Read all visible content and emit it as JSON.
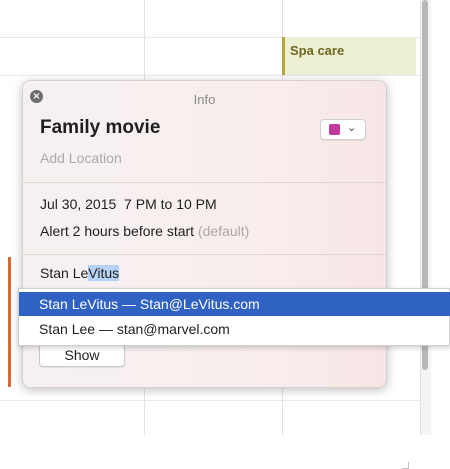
{
  "calendar": {
    "event_spa": {
      "label": "Spa care",
      "color": "#eef0d4"
    }
  },
  "popover": {
    "header": "Info",
    "event_title": "Family movie",
    "location_placeholder": "Add Location",
    "color_swatch": "#c2399b",
    "date_time": "Jul 30, 2015  7 PM to 10 PM",
    "alert_text": "Alert 2 hours before start",
    "alert_default": "(default)",
    "invitee_typed": "Stan Le",
    "invitee_completion": "Vitus",
    "show_button": "Show"
  },
  "autocomplete": {
    "items": [
      {
        "label": "Stan LeVitus — Stan@LeVitus.com",
        "selected": true
      },
      {
        "label": "Stan Lee — stan@marvel.com",
        "selected": false
      }
    ],
    "highlight_color": "#2f62c3"
  },
  "icons": {
    "close": "close-icon",
    "dropdown": "chevron-down-icon"
  }
}
